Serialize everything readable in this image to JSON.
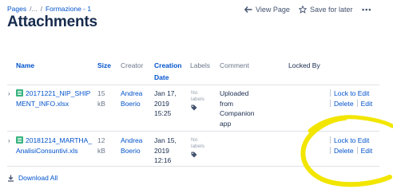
{
  "breadcrumb": {
    "items": [
      "Pages",
      "/...",
      "/",
      "Formazione - 1"
    ]
  },
  "page_title": "Attachments",
  "actions": {
    "view_page": "View Page",
    "save_for_later": "Save for later",
    "more": "•••"
  },
  "table": {
    "headers": {
      "name": "Name",
      "size": "Size",
      "creator": "Creator",
      "creation_date_1": "Creation",
      "creation_date_2": "Date",
      "labels": "Labels",
      "comment": "Comment",
      "locked_by": "Locked By"
    },
    "rows": [
      {
        "name_1": "20171221_NIP_SHIP",
        "name_2": "MENT_INFO.xlsx",
        "size_1": "15",
        "size_2": "kB",
        "creator_1": "Andrea",
        "creator_2": "Boerio",
        "date_1": "Jan 17,",
        "date_2": "2019",
        "date_3": "15:25",
        "labels_1": "No",
        "labels_2": "labels",
        "comment_1": "Uploaded",
        "comment_2": "from",
        "comment_3": "Companion",
        "comment_4": "app",
        "lock": "Lock to Edit",
        "delete": "Delete",
        "edit": "Edit"
      },
      {
        "name_1": "20181214_MARTHA_",
        "name_2": "AnalisiConsuntivi.xls",
        "size_1": "12",
        "size_2": "kB",
        "creator_1": "Andrea",
        "creator_2": "Boerio",
        "date_1": "Jan 15,",
        "date_2": "2019",
        "date_3": "12:16",
        "labels_1": "No",
        "labels_2": "labels",
        "lock": "Lock to Edit",
        "delete": "Delete",
        "edit": "Edit"
      }
    ]
  },
  "download_all": "Download All",
  "colors": {
    "link": "#0052cc",
    "highlight": "#f2e600",
    "excel": "#36b37e"
  }
}
